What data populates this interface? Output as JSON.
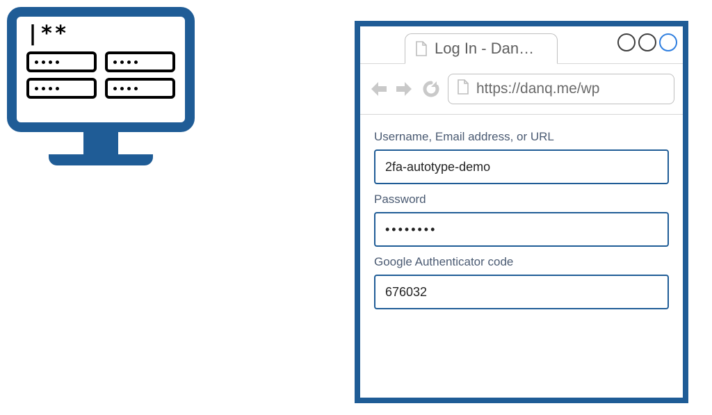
{
  "illustration": {
    "masked_prompt": "|**"
  },
  "browser": {
    "tab_title": "Log In - Dan…",
    "url": "https://danq.me/wp"
  },
  "form": {
    "username_label": "Username, Email address, or URL",
    "username_value": "2fa-autotype-demo",
    "password_label": "Password",
    "password_value": "••••••••",
    "code_label": "Google Authenticator code",
    "code_value": "676032"
  },
  "colors": {
    "frame_blue": "#1f5c96"
  }
}
